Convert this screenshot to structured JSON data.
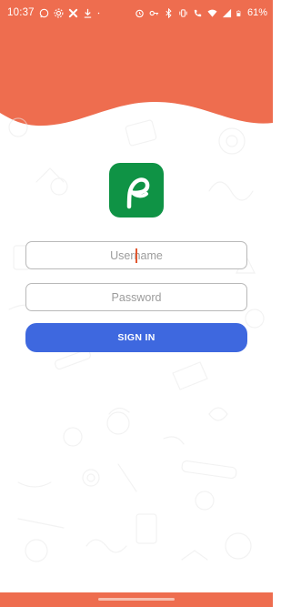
{
  "status_bar": {
    "time": "10:37",
    "battery_percent": "61%",
    "left_icons": [
      "whatsapp-icon",
      "settings-icon",
      "fan-icon",
      "download-icon",
      "dot-icon"
    ],
    "right_icons": [
      "alarm-icon",
      "key-icon",
      "bluetooth-icon",
      "vibrate-icon",
      "call-icon",
      "wifi-icon",
      "signal-icon",
      "battery-icon"
    ]
  },
  "login": {
    "username_placeholder": "Username",
    "password_placeholder": "Password",
    "signin_label": "SIGN IN"
  },
  "colors": {
    "header": "#ee6d4f",
    "logo_bg": "#0f9345",
    "button": "#3e68df",
    "bottom_bar": "#ee6d4f"
  }
}
